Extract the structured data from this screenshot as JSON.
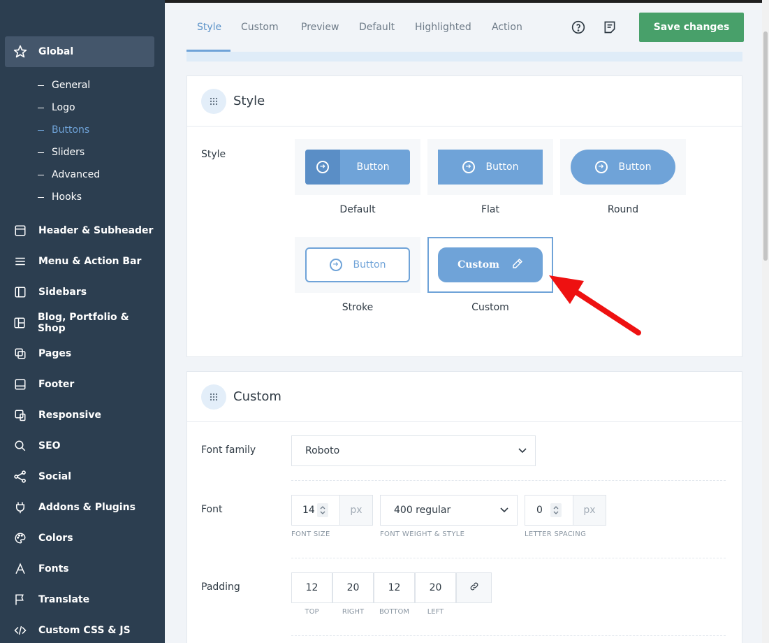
{
  "sidebar": {
    "global": {
      "label": "Global",
      "icon": "star-icon"
    },
    "sub_items": [
      {
        "label": "General",
        "active": false
      },
      {
        "label": "Logo",
        "active": false
      },
      {
        "label": "Buttons",
        "active": true
      },
      {
        "label": "Sliders",
        "active": false
      },
      {
        "label": "Advanced",
        "active": false
      },
      {
        "label": "Hooks",
        "active": false
      }
    ],
    "items": [
      {
        "label": "Header & Subheader",
        "icon": "header-icon"
      },
      {
        "label": "Menu & Action Bar",
        "icon": "menu-icon"
      },
      {
        "label": "Sidebars",
        "icon": "sidebar-icon"
      },
      {
        "label": "Blog, Portfolio & Shop",
        "icon": "layout-icon"
      },
      {
        "label": "Pages",
        "icon": "pages-icon"
      },
      {
        "label": "Footer",
        "icon": "footer-icon"
      },
      {
        "label": "Responsive",
        "icon": "responsive-icon"
      },
      {
        "label": "SEO",
        "icon": "search-icon"
      },
      {
        "label": "Social",
        "icon": "share-icon"
      },
      {
        "label": "Addons & Plugins",
        "icon": "plug-icon"
      },
      {
        "label": "Colors",
        "icon": "palette-icon"
      },
      {
        "label": "Fonts",
        "icon": "font-icon"
      },
      {
        "label": "Translate",
        "icon": "flag-icon"
      },
      {
        "label": "Custom CSS & JS",
        "icon": "code-icon"
      }
    ]
  },
  "tabs": [
    "Style",
    "Custom",
    "Preview",
    "Default",
    "Highlighted",
    "Action"
  ],
  "active_tab": "Style",
  "toolbar": {
    "save_label": "Save changes",
    "help_icon": "help-icon",
    "notes_icon": "notes-icon"
  },
  "style_card": {
    "title": "Style",
    "field_label": "Style",
    "options": [
      {
        "caption": "Default",
        "button_text": "Button"
      },
      {
        "caption": "Flat",
        "button_text": "Button"
      },
      {
        "caption": "Round",
        "button_text": "Button"
      },
      {
        "caption": "Stroke",
        "button_text": "Button"
      },
      {
        "caption": "Custom",
        "button_text": "Custom",
        "selected": true
      }
    ]
  },
  "custom_card": {
    "title": "Custom",
    "font_family": {
      "label": "Font family",
      "value": "Roboto"
    },
    "font": {
      "label": "Font",
      "size": "14",
      "size_unit": "px",
      "size_caption": "FONT SIZE",
      "weight": "400 regular",
      "weight_caption": "FONT WEIGHT & STYLE",
      "spacing": "0",
      "spacing_unit": "px",
      "spacing_caption": "LETTER SPACING"
    },
    "padding": {
      "label": "Padding",
      "values": [
        "12",
        "20",
        "12",
        "20"
      ],
      "captions": [
        "TOP",
        "RIGHT",
        "BOTTOM",
        "LEFT"
      ]
    }
  },
  "colors": {
    "sidebar": "#2c3e50",
    "accent": "#6fa3d8",
    "save": "#48a06a",
    "annotation_arrow": "#ee1111"
  }
}
